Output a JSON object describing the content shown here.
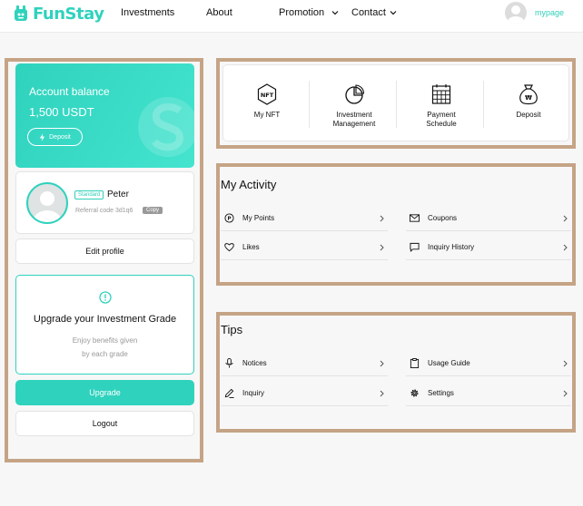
{
  "brand": {
    "name": "FunStay",
    "color": "#2fd2bd"
  },
  "nav": {
    "items": [
      {
        "label": "Investments"
      },
      {
        "label": "About"
      },
      {
        "label": "Promotion"
      },
      {
        "label": "Contact"
      }
    ],
    "mypage_label": "mypage"
  },
  "account": {
    "balance_label": "Account balance",
    "balance_value": "1,500 USDT",
    "deposit_label": "Deposit"
  },
  "profile": {
    "grade": "Standard",
    "name": "Peter",
    "referral": "Referral code 3d1q6",
    "copy_label": "Copy",
    "edit_label": "Edit profile"
  },
  "upgrade": {
    "title": "Upgrade your Investment Grade",
    "desc_line1": "Enjoy benefits given",
    "desc_line2": "by each grade",
    "button_label": "Upgrade"
  },
  "logout_label": "Logout",
  "quick": [
    {
      "line1": "My NFT",
      "line2": "",
      "icon": "nft-icon"
    },
    {
      "line1": "Investment",
      "line2": "Management",
      "icon": "pie-chart-icon"
    },
    {
      "line1": "Payment",
      "line2": "Schedule",
      "icon": "calendar-icon"
    },
    {
      "line1": "Deposit",
      "line2": "",
      "icon": "money-bag-icon"
    }
  ],
  "activity": {
    "title": "My Activity",
    "items": [
      {
        "label": "My Points",
        "icon": "points-icon"
      },
      {
        "label": "Coupons",
        "icon": "mail-icon"
      },
      {
        "label": "Likes",
        "icon": "heart-icon"
      },
      {
        "label": "Inquiry History",
        "icon": "chat-icon"
      }
    ]
  },
  "tips": {
    "title": "Tips",
    "items": [
      {
        "label": "Notices",
        "icon": "microphone-icon"
      },
      {
        "label": "Usage Guide",
        "icon": "clipboard-icon"
      },
      {
        "label": "Inquiry",
        "icon": "pencil-icon"
      },
      {
        "label": "Settings",
        "icon": "gear-icon"
      }
    ]
  },
  "colors": {
    "accent": "#2fd2bd",
    "frame": "#c5a486",
    "muted": "#999999"
  }
}
